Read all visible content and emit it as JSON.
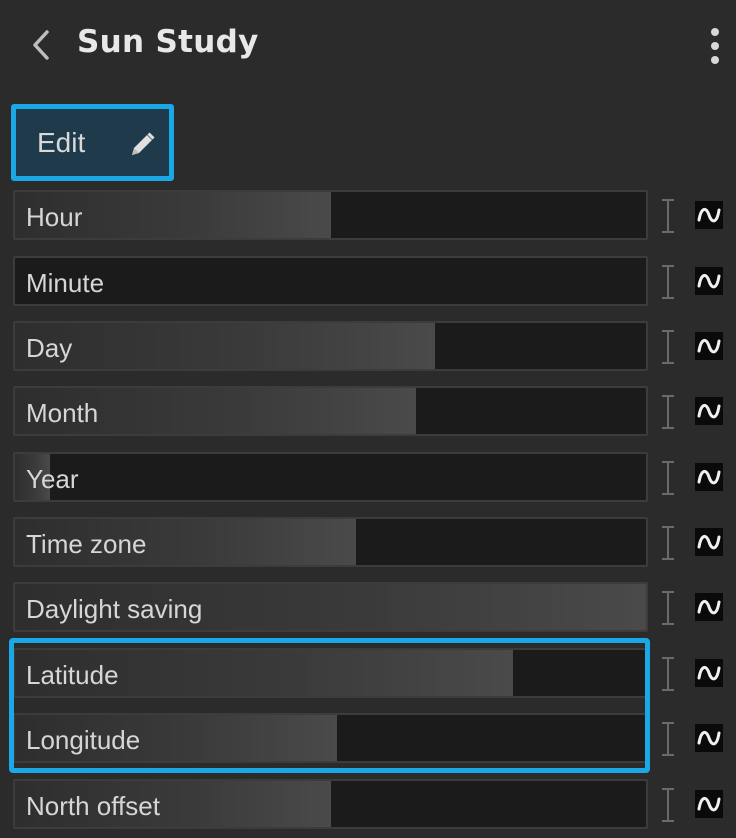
{
  "header": {
    "title": "Sun Study"
  },
  "edit": {
    "label": "Edit"
  },
  "params": [
    {
      "label": "Hour",
      "fill": 0.5
    },
    {
      "label": "Minute",
      "fill": 0.0
    },
    {
      "label": "Day",
      "fill": 0.665
    },
    {
      "label": "Month",
      "fill": 0.635
    },
    {
      "label": "Year",
      "fill": 0.055
    },
    {
      "label": "Time zone",
      "fill": 0.54
    },
    {
      "label": "Daylight saving",
      "fill": 1.0
    },
    {
      "label": "Latitude",
      "fill": 0.79
    },
    {
      "label": "Longitude",
      "fill": 0.51
    },
    {
      "label": "North offset",
      "fill": 0.5
    }
  ],
  "colors": {
    "accent": "#1aa8e6",
    "background": "#2b2b2b",
    "slider_bg": "#1b1b1b"
  }
}
